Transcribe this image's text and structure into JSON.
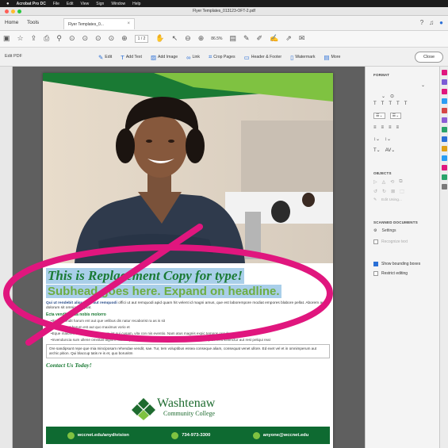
{
  "menubar": {
    "app": "Acrobat Pro DC",
    "items": [
      "File",
      "Edit",
      "View",
      "Sign",
      "Window",
      "Help"
    ]
  },
  "window": {
    "title": "Flyer Templates_013123-OFT-2.pdf"
  },
  "tabs": {
    "home": "Home",
    "tools": "Tools",
    "document": "Flyer Templates_0..."
  },
  "toolbar": {
    "page": "1 / 2",
    "zoom": "86.5%"
  },
  "editbar": {
    "label": "Edit PDF",
    "tools": [
      "Edit",
      "Add Text",
      "Add Image",
      "Link",
      "Crop Pages",
      "Header & Footer",
      "Watermark",
      "More"
    ],
    "close": "Close"
  },
  "flyer": {
    "headline": "This is Replacement Copy for type!",
    "subhead": "Subhead goes here. Expand on headline.",
    "intro_bold": "Qui ut rendebit aliquati ut aut remquodi",
    "intro": "offici ut aut remquodi apid quam hit velent id magni amus, que est laborempore modiat empores blabore pellat. Aborem aut dolorum sit omnia doluptat.",
    "list_heading": "Ecta vendita ipsa nobis molorro",
    "bullets": [
      "•Ita consendit harum ent aut que velibus dis natur recaborist ra as is sit",
      "•Mo consent harum est aut quo maximus vorio et",
      "•Eque maiores ciuntibusdam faccum int qui cusam, vita con nis eventio. Nam atus magnis expic tempos occulpa ruribus id",
      "•Invenduncia sum ullene omnitas dignim nobitatque tes ullaturit, ipita pa eos sita pratiam veribu sapiet renit siminctur aut rest peliqui reat"
    ],
    "body": "Ore sandipsunt repe que mia minciposam rehendae vendit, sae. Tur, tem voluptibus essea conseque aliam, consequat venet ullore. Ed exet vel et in omnimperum aut archic pition. Qui blaccup tatis re is et, quo borunitm",
    "cta": "Contact Us Today!",
    "logo_name": "Washtenaw",
    "logo_sub": "Community College",
    "footer": {
      "web": "wccnet.edu/anydivision",
      "phone": "734-973-3300",
      "email": "anyone@wccnet.edu"
    }
  },
  "rightpanel": {
    "format": "FORMAT",
    "objects": "OBJECTS",
    "edit_using": "Edit Using...",
    "scanned": "SCANNED DOCUMENTS",
    "settings": "Settings",
    "recognize": "Recognize text",
    "show_boxes": "Show bounding boxes",
    "restrict": "Restrict editing"
  },
  "colors": {
    "brand_green": "#0e6a31",
    "light_green": "#7fc241",
    "annotation": "#e0167e",
    "selection": "#a9cfe9"
  }
}
